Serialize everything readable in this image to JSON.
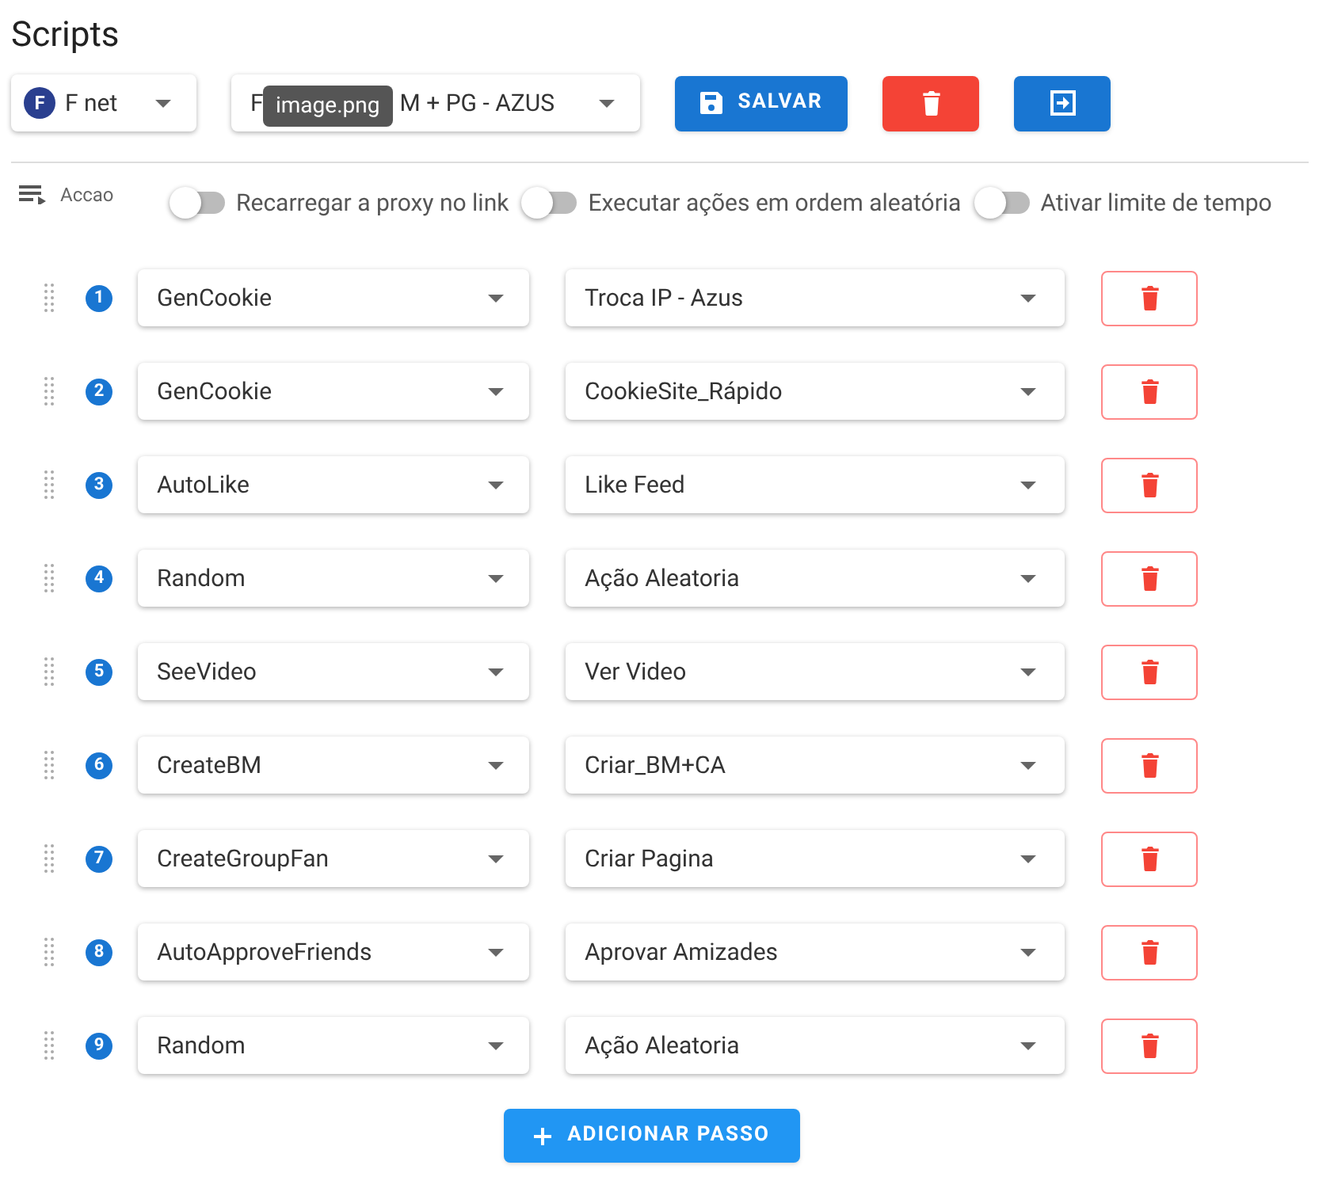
{
  "page": {
    "title": "Scripts"
  },
  "toolbar": {
    "account": {
      "avatar": "F",
      "value": "F net"
    },
    "script_select": {
      "value_start": "F",
      "value_end": "M + PG - AZUS"
    },
    "tooltip": "image.png",
    "save_button": "SALVAR"
  },
  "options": {
    "menu_label": "Accao",
    "toggles": [
      {
        "label": "Recarregar a proxy no link",
        "on": false
      },
      {
        "label": "Executar ações em ordem aleatória",
        "on": false
      },
      {
        "label": "Ativar limite de tempo",
        "on": false
      }
    ]
  },
  "steps": [
    {
      "number": "1",
      "action": "GenCookie",
      "script": "Troca IP - Azus"
    },
    {
      "number": "2",
      "action": "GenCookie",
      "script": "CookieSite_Rápido"
    },
    {
      "number": "3",
      "action": "AutoLike",
      "script": "Like Feed"
    },
    {
      "number": "4",
      "action": "Random",
      "script": "Ação Aleatoria"
    },
    {
      "number": "5",
      "action": "SeeVideo",
      "script": "Ver Video"
    },
    {
      "number": "6",
      "action": "CreateBM",
      "script": "Criar_BM+CA"
    },
    {
      "number": "7",
      "action": "CreateGroupFan",
      "script": "Criar Pagina"
    },
    {
      "number": "8",
      "action": "AutoApproveFriends",
      "script": "Aprovar Amizades"
    },
    {
      "number": "9",
      "action": "Random",
      "script": "Ação Aleatoria"
    }
  ],
  "add_button": "ADICIONAR PASSO"
}
